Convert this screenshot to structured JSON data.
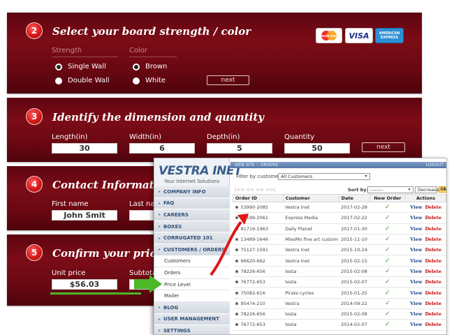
{
  "step2": {
    "number": "2",
    "title": "Select your board strength / color",
    "strength_label": "Strength",
    "color_label": "Color",
    "strength_options": [
      "Single Wall",
      "Double Wall"
    ],
    "color_options": [
      "Brown",
      "White"
    ],
    "next_label": "next",
    "cards": [
      "MasterCard",
      "VISA",
      "AMERICAN EXPRESS"
    ]
  },
  "step3": {
    "number": "3",
    "title": "Identify the dimension and quantity",
    "length_label": "Length(in)",
    "length_value": "30",
    "width_label": "Width(in)",
    "width_value": "6",
    "depth_label": "Depth(in)",
    "depth_value": "5",
    "quantity_label": "Quantity",
    "quantity_value": "50",
    "next_label": "next"
  },
  "step4": {
    "number": "4",
    "title": "Contact Informatio",
    "first_name_label": "First name",
    "first_name_value": "John Smit",
    "last_name_label": "Last na"
  },
  "step5": {
    "number": "5",
    "title": "Confirm your price",
    "unit_price_label": "Unit price",
    "unit_price_value": "$56.03",
    "subtotal_label": "Subtota"
  },
  "admin": {
    "logo": "VESTRA INET",
    "logo_tagline": "Your Internet Solutions",
    "topbar_left": "WEB SITE :: ORDERS",
    "topbar_right": "LOGOUT",
    "menu": [
      {
        "label": "COMPANY INFO",
        "sub": false
      },
      {
        "label": "FAQ",
        "sub": false
      },
      {
        "label": "CAREERS",
        "sub": false
      },
      {
        "label": "BOXES",
        "sub": false
      },
      {
        "label": "CORRUGATED 101",
        "sub": false
      },
      {
        "label": "CUSTOMERS / ORDERS",
        "sub": false
      },
      {
        "label": "Customers",
        "sub": true
      },
      {
        "label": "Orders",
        "sub": true
      },
      {
        "label": "Price Level",
        "sub": true
      },
      {
        "label": "Mailer",
        "sub": true
      },
      {
        "label": "BLOG",
        "sub": false
      },
      {
        "label": "USER MANAGEMENT",
        "sub": false
      },
      {
        "label": "SETTINGS",
        "sub": false
      }
    ],
    "filter_label": "Filter by customer:",
    "filter_value": "All Customers",
    "pager": "|<< << >> >>|",
    "sort_label": "Sort by:",
    "sort_value": "--------",
    "order_value": "Decrease",
    "ok_label": "Ok",
    "columns": [
      "Order ID",
      "Customer",
      "Date",
      "New Order",
      "Actions"
    ],
    "view_label": "View",
    "delete_label": "Delete",
    "check_icon": "check-icon",
    "rows": [
      {
        "id": "53990-2085",
        "customer": "Vestra Inet",
        "date": "2017-02-28"
      },
      {
        "id": "81199-2061",
        "customer": "Express Media",
        "date": "2017-02-22"
      },
      {
        "id": "81719-1963",
        "customer": "Daily Planet",
        "date": "2017-01-30"
      },
      {
        "id": "13489-1646",
        "customer": "MiesMo fine art custom",
        "date": "2015-11-10"
      },
      {
        "id": "75127-1591",
        "customer": "Vestra Inet",
        "date": "2015-10-24"
      },
      {
        "id": "66620-662",
        "customer": "Vestra Inet",
        "date": "2015-02-15"
      },
      {
        "id": "78226-656",
        "customer": "testa",
        "date": "2015-02-08"
      },
      {
        "id": "76772-653",
        "customer": "testa",
        "date": "2015-02-07"
      },
      {
        "id": "75082-616",
        "customer": "Pirate cycles",
        "date": "2015-01-25"
      },
      {
        "id": "95474-210",
        "customer": "Vestra",
        "date": "2014-09-22"
      },
      {
        "id": "78226-656",
        "customer": "testa",
        "date": "2015-02-08"
      },
      {
        "id": "76772-653",
        "customer": "testa",
        "date": "2014-02-07"
      }
    ]
  },
  "colors": {
    "panel": "#6a0812",
    "step_badge": "#d81818",
    "admin_blue": "#3b5d8a",
    "check": "#3a9a2c",
    "arrow_red": "#e01818",
    "arrow_green": "#4cb828"
  }
}
